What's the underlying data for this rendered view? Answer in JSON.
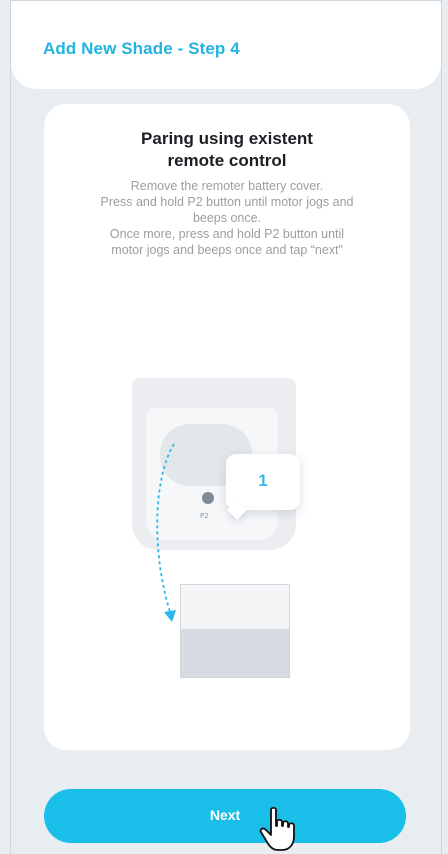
{
  "header": {
    "title": "Add New Shade - Step 4"
  },
  "card": {
    "title": "Paring using existent\nremote control",
    "description": "Remove the remoter battery cover.\nPress and hold P2 button until motor jogs and\nbeeps once.\nOnce more, press and hold P2 button until\nmotor jogs and beeps once and tap “next”"
  },
  "illustration": {
    "button_label": "P2",
    "bubble_number": "1"
  },
  "footer": {
    "next_label": "Next"
  },
  "colors": {
    "accent": "#19bfe8",
    "title_accent": "#22b3e0",
    "background": "#e8edf1"
  },
  "icons": {
    "cursor": "hand-pointer-icon",
    "arrow": "dashed-curved-arrow-icon"
  }
}
